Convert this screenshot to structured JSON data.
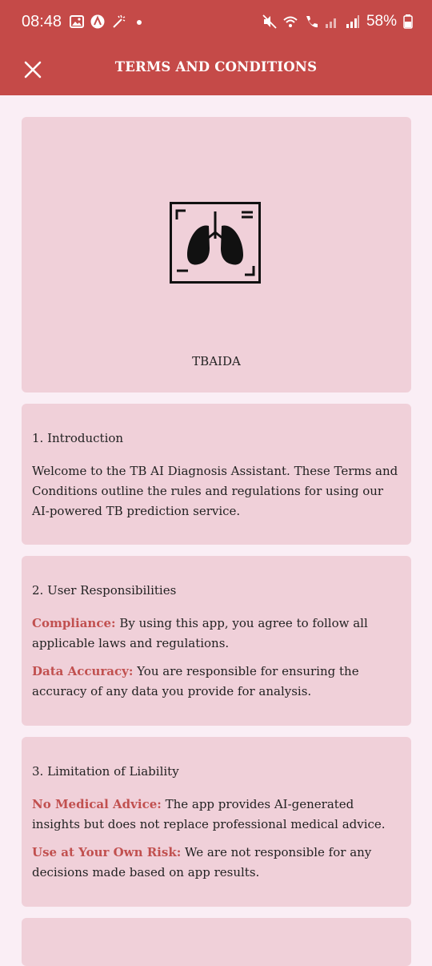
{
  "status_bar": {
    "time": "08:48",
    "battery": "58%"
  },
  "app_bar": {
    "title": "TERMS AND CONDITIONS"
  },
  "logo": {
    "app_name": "TBAIDA"
  },
  "sections": [
    {
      "title": "1. Introduction",
      "body": "Welcome to the TB AI Diagnosis Assistant. These Terms and Conditions outline the rules and regulations for using our AI-powered TB prediction service."
    },
    {
      "title": "2. User Responsibilities",
      "items": [
        {
          "term": "Compliance:",
          "text": " By using this app, you agree to follow all applicable laws and regulations."
        },
        {
          "term": "Data Accuracy:",
          "text": " You are responsible for ensuring the accuracy of any data you provide for analysis."
        }
      ]
    },
    {
      "title": "3. Limitation of Liability",
      "items": [
        {
          "term": "No Medical Advice:",
          "text": " The app provides AI-generated insights but does not replace professional medical advice."
        },
        {
          "term": "Use at Your Own Risk:",
          "text": " We are not responsible for any decisions made based on app results."
        }
      ]
    }
  ],
  "colors": {
    "primary": "#c54a48",
    "background": "#faeef5",
    "card": "#f0d0d9",
    "term": "#c1504f"
  }
}
